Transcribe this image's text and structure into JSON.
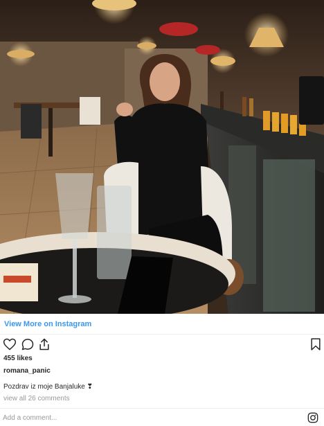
{
  "post": {
    "view_more_label": "View More on Instagram",
    "likes": "455 likes",
    "username": "romana_panic",
    "caption": "Pozdrav iz moje Banjaluke ❣",
    "view_comments": "view all 26 comments",
    "comment_placeholder": "Add a comment..."
  },
  "icons": {
    "like": "heart-icon",
    "comment": "comment-icon",
    "share": "share-icon",
    "save": "bookmark-icon",
    "brand": "instagram-logo-icon"
  },
  "colors": {
    "link": "#3897f0",
    "text": "#262626",
    "muted": "#999999",
    "divider": "#efefef"
  }
}
